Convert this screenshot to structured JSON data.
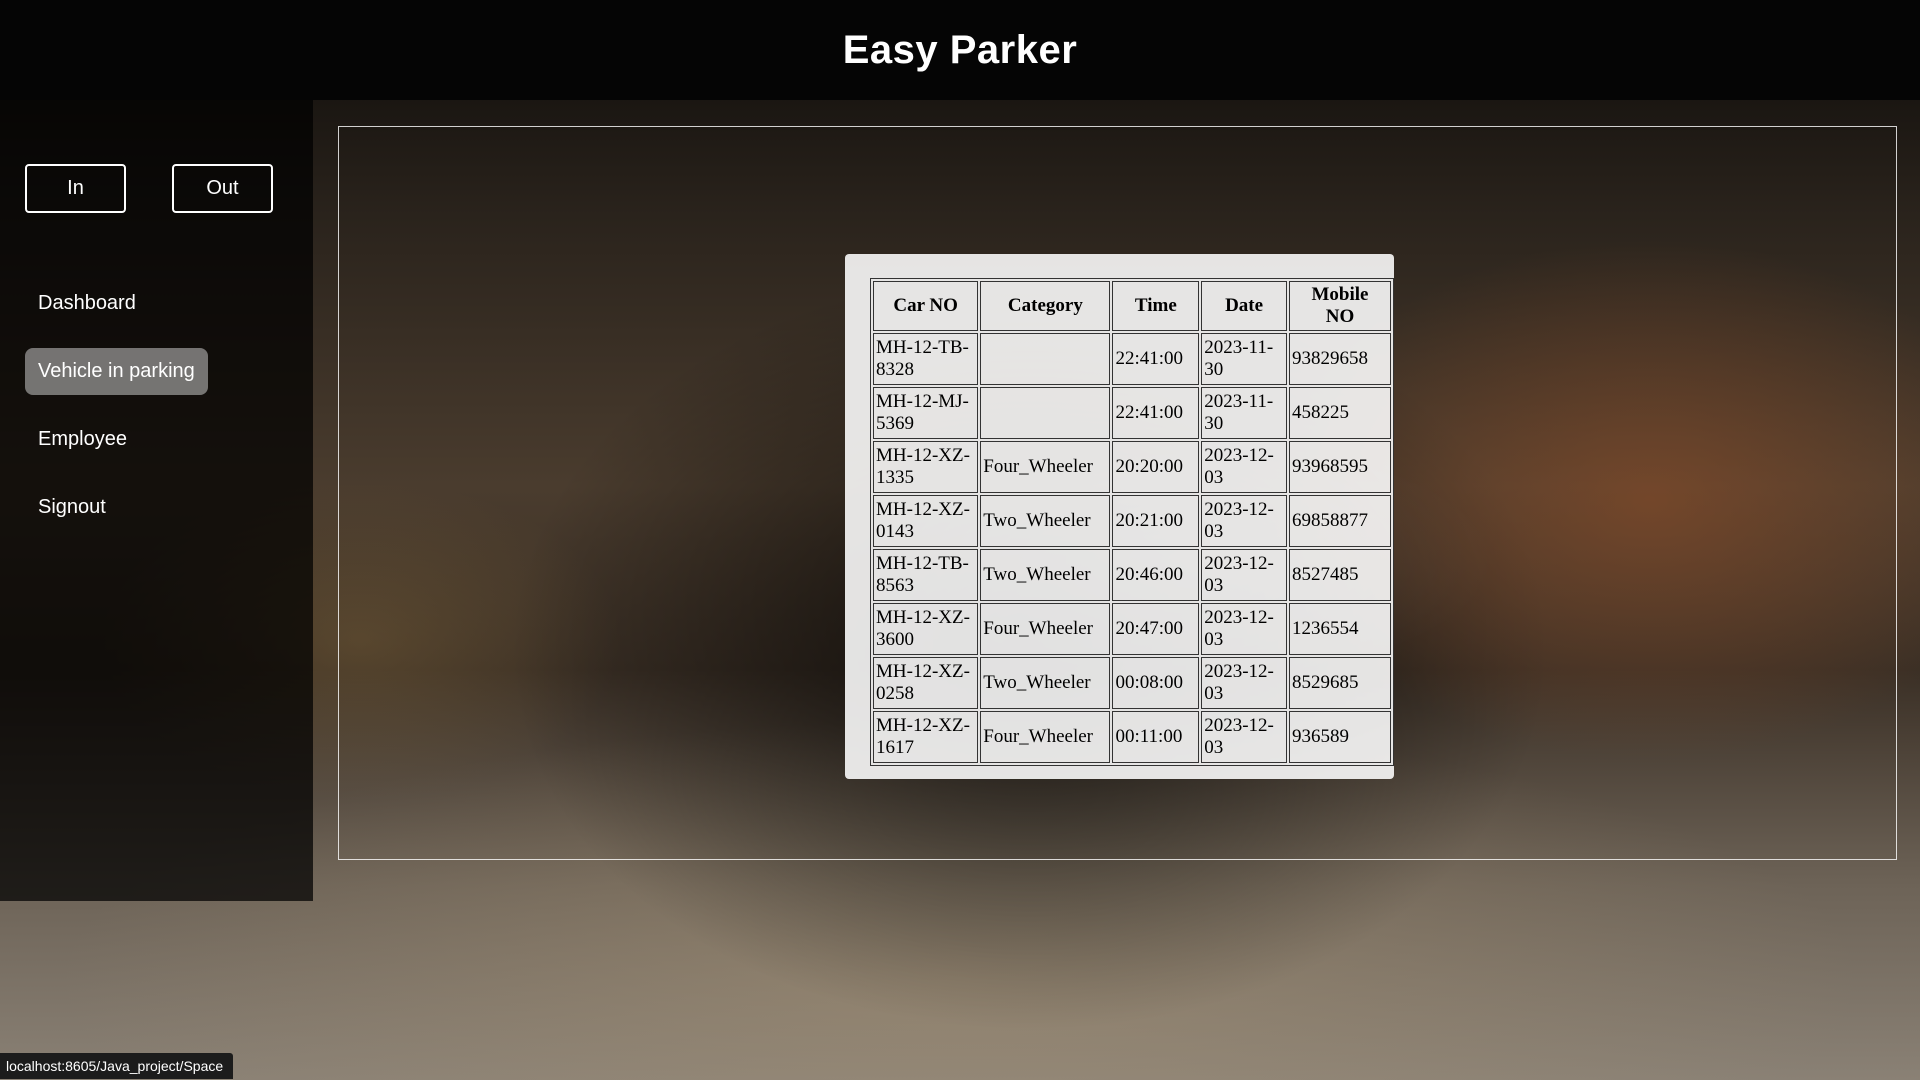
{
  "app": {
    "title": "Easy Parker"
  },
  "sidebar": {
    "in_label": "In",
    "out_label": "Out",
    "nav": [
      {
        "label": "Dashboard",
        "active": false
      },
      {
        "label": "Vehicle in parking",
        "active": true
      },
      {
        "label": "Employee",
        "active": false
      },
      {
        "label": "Signout",
        "active": false
      }
    ]
  },
  "table": {
    "headers": [
      "Car NO",
      "Category",
      "Time",
      "Date",
      "Mobile NO"
    ],
    "rows": [
      [
        "MH-12-TB-8328",
        "",
        "22:41:00",
        "2023-11-30",
        "93829658"
      ],
      [
        "MH-12-MJ-5369",
        "",
        "22:41:00",
        "2023-11-30",
        "458225"
      ],
      [
        "MH-12-XZ-1335",
        "Four_Wheeler",
        "20:20:00",
        "2023-12-03",
        "93968595"
      ],
      [
        "MH-12-XZ-0143",
        "Two_Wheeler",
        "20:21:00",
        "2023-12-03",
        "69858877"
      ],
      [
        "MH-12-TB-8563",
        "Two_Wheeler",
        "20:46:00",
        "2023-12-03",
        "8527485"
      ],
      [
        "MH-12-XZ-3600",
        "Four_Wheeler",
        "20:47:00",
        "2023-12-03",
        "1236554"
      ],
      [
        "MH-12-XZ-0258",
        "Two_Wheeler",
        "00:08:00",
        "2023-12-03",
        "8529685"
      ],
      [
        "MH-12-XZ-1617",
        "Four_Wheeler",
        "00:11:00",
        "2023-12-03",
        "936589"
      ]
    ]
  },
  "statusbar": {
    "url": "localhost:8605/Java_project/Space"
  }
}
